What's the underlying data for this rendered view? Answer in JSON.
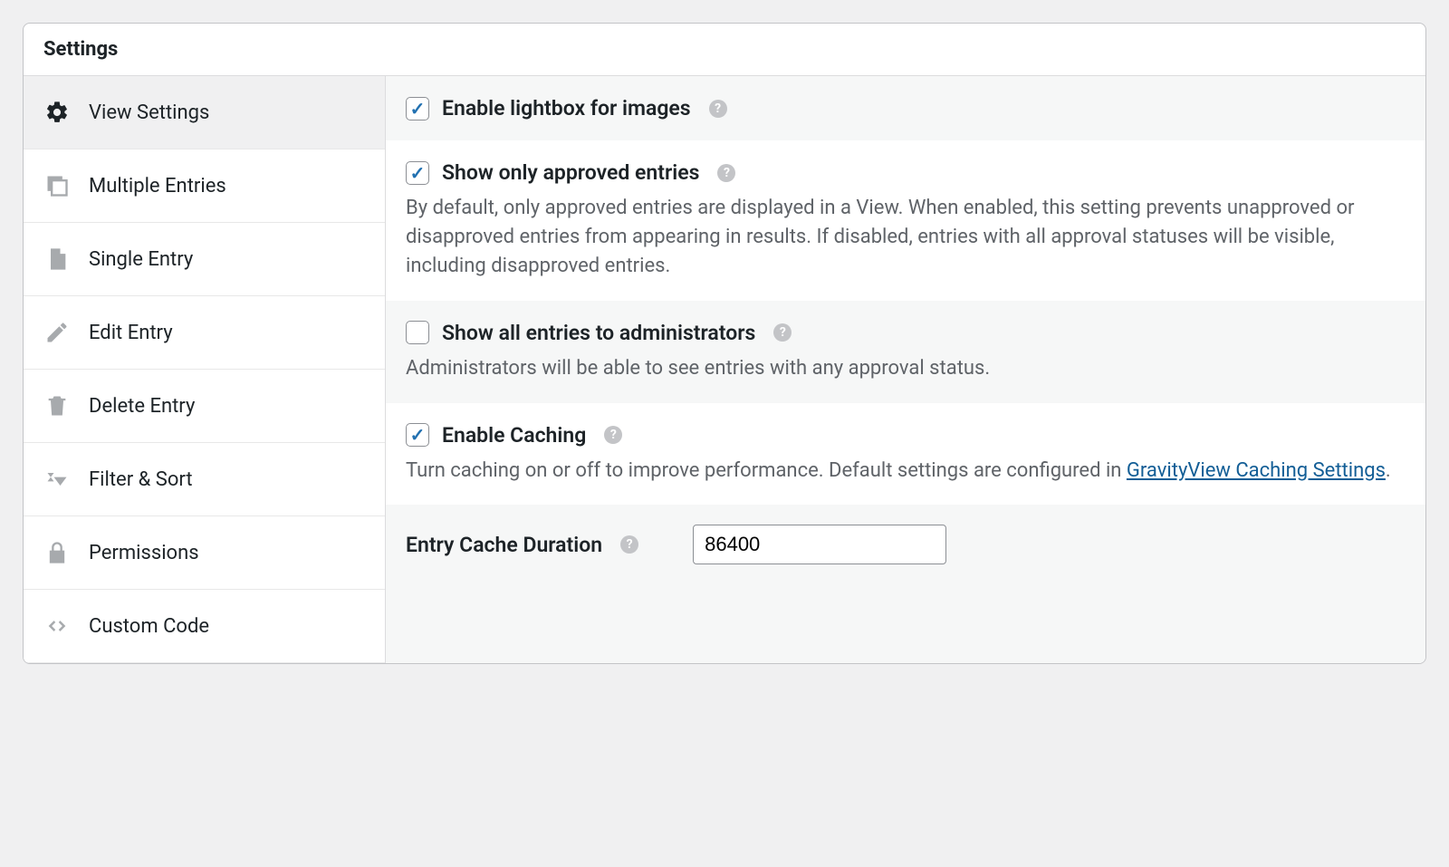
{
  "header": {
    "title": "Settings"
  },
  "sidebar": {
    "items": [
      {
        "label": "View Settings"
      },
      {
        "label": "Multiple Entries"
      },
      {
        "label": "Single Entry"
      },
      {
        "label": "Edit Entry"
      },
      {
        "label": "Delete Entry"
      },
      {
        "label": "Filter & Sort"
      },
      {
        "label": "Permissions"
      },
      {
        "label": "Custom Code"
      }
    ]
  },
  "fields": {
    "lightbox": {
      "label": "Enable lightbox for images"
    },
    "approved": {
      "label": "Show only approved entries",
      "desc": "By default, only approved entries are displayed in a View. When enabled, this setting prevents unapproved or disapproved entries from appearing in results. If disabled, entries with all approval statuses will be visible, including disapproved entries."
    },
    "show_all_admin": {
      "label": "Show all entries to administrators",
      "desc": "Administrators will be able to see entries with any approval status."
    },
    "caching": {
      "label": "Enable Caching",
      "desc_prefix": "Turn caching on or off to improve performance. Default settings are configured in ",
      "desc_link": "GravityView Caching Settings",
      "desc_suffix": "."
    },
    "cache_duration": {
      "label": "Entry Cache Duration",
      "value": "86400"
    }
  }
}
